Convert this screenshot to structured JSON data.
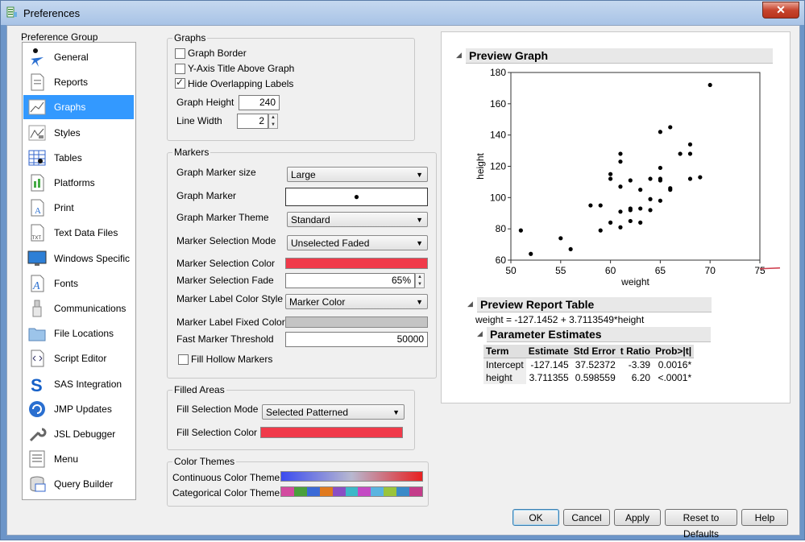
{
  "window": {
    "title": "Preferences",
    "close_glyph": "✕"
  },
  "sidebar": {
    "heading": "Preference Group",
    "items": [
      {
        "label": "General",
        "icon": "general-icon"
      },
      {
        "label": "Reports",
        "icon": "reports-icon"
      },
      {
        "label": "Graphs",
        "icon": "graphs-icon",
        "selected": true
      },
      {
        "label": "Styles",
        "icon": "styles-icon"
      },
      {
        "label": "Tables",
        "icon": "tables-icon"
      },
      {
        "label": "Platforms",
        "icon": "platforms-icon"
      },
      {
        "label": "Print",
        "icon": "print-icon"
      },
      {
        "label": "Text Data Files",
        "icon": "text-data-files-icon"
      },
      {
        "label": "Windows Specific",
        "icon": "monitor-icon"
      },
      {
        "label": "Fonts",
        "icon": "fonts-icon"
      },
      {
        "label": "Communications",
        "icon": "usb-icon"
      },
      {
        "label": "File Locations",
        "icon": "folder-icon"
      },
      {
        "label": "Script Editor",
        "icon": "script-editor-icon"
      },
      {
        "label": "SAS Integration",
        "icon": "sas-icon"
      },
      {
        "label": "JMP Updates",
        "icon": "updates-icon"
      },
      {
        "label": "JSL Debugger",
        "icon": "wrench-icon"
      },
      {
        "label": "Menu",
        "icon": "menu-icon"
      },
      {
        "label": "Query Builder",
        "icon": "database-icon"
      }
    ]
  },
  "graphs": {
    "title": "Graphs",
    "graph_border": {
      "label": "Graph Border",
      "checked": false
    },
    "y_axis_title": {
      "label": "Y-Axis Title Above Graph",
      "checked": false
    },
    "hide_overlap": {
      "label": "Hide Overlapping Labels",
      "checked": true
    },
    "graph_height_label": "Graph Height",
    "graph_height": "240",
    "line_width_label": "Line Width",
    "line_width": "2"
  },
  "markers": {
    "title": "Markers",
    "size_label": "Graph Marker size",
    "size_value": "Large",
    "marker_label": "Graph Marker",
    "marker_glyph": "●",
    "theme_label": "Graph Marker Theme",
    "theme_value": "Standard",
    "selection_mode_label": "Marker Selection Mode",
    "selection_mode_value": "Unselected Faded",
    "selection_color_label": "Marker Selection Color",
    "selection_color": "#f03a4a",
    "fade_label": "Marker Selection Fade",
    "fade_value": "65%",
    "label_style_label": "Marker Label Color Style",
    "label_style_value": "Marker Color",
    "label_fixed_label": "Marker Label Fixed Color",
    "label_fixed_color": "#c4c4c4",
    "threshold_label": "Fast Marker Threshold",
    "threshold_value": "50000",
    "fill_hollow": {
      "label": "Fill Hollow Markers",
      "checked": false
    }
  },
  "filled_areas": {
    "title": "Filled Areas",
    "mode_label": "Fill Selection Mode",
    "mode_value": "Selected Patterned",
    "color_label": "Fill Selection Color",
    "color": "#f03a4a"
  },
  "color_themes": {
    "title": "Color Themes",
    "continuous_label": "Continuous Color Theme",
    "continuous_colors": [
      "#3b4cf0",
      "#b8b8d0",
      "#e82020"
    ],
    "categorical_label": "Categorical Color Theme",
    "categorical_colors": [
      "#d34ba0",
      "#4aa03c",
      "#3b6ad6",
      "#e07a1e",
      "#8a4fc4",
      "#3db8c8",
      "#c44ac4",
      "#5ab4e0",
      "#9ac43c",
      "#3a8ac8",
      "#c43c8a"
    ]
  },
  "preview": {
    "graph_title": "Preview Graph",
    "report_title": "Preview Report Table",
    "equation": "weight = -127.1452 + 3.7113549*height",
    "param_title": "Parameter Estimates",
    "table": {
      "headers": [
        "Term",
        "Estimate",
        "Std Error",
        "t Ratio",
        "Prob>|t|"
      ],
      "rows": [
        [
          "Intercept",
          "-127.145",
          "37.52372",
          "-3.39",
          "0.0016*"
        ],
        [
          "height",
          "3.711355",
          "0.598559",
          "6.20",
          "<.0001*"
        ]
      ]
    }
  },
  "chart_data": {
    "type": "scatter",
    "xlabel": "weight",
    "ylabel": "height",
    "xlim": [
      50,
      75
    ],
    "ylim": [
      60,
      180
    ],
    "xticks": [
      50,
      55,
      60,
      65,
      70,
      75
    ],
    "yticks": [
      60,
      80,
      100,
      120,
      140,
      160,
      180
    ],
    "fit_line": {
      "intercept": -127.1452,
      "slope": 3.7113549,
      "color": "#d04050"
    },
    "points": [
      [
        51,
        79
      ],
      [
        52,
        64
      ],
      [
        55,
        74
      ],
      [
        56,
        67
      ],
      [
        58,
        95
      ],
      [
        59,
        79
      ],
      [
        59,
        95
      ],
      [
        60,
        84
      ],
      [
        60,
        112
      ],
      [
        60,
        115
      ],
      [
        61,
        81
      ],
      [
        61,
        91
      ],
      [
        61,
        107
      ],
      [
        61,
        123
      ],
      [
        61,
        128
      ],
      [
        62,
        85
      ],
      [
        62,
        92
      ],
      [
        62,
        93
      ],
      [
        62,
        111
      ],
      [
        63,
        84
      ],
      [
        63,
        93
      ],
      [
        63,
        105
      ],
      [
        64,
        92
      ],
      [
        64,
        99
      ],
      [
        64,
        112
      ],
      [
        65,
        98
      ],
      [
        65,
        111
      ],
      [
        65,
        112
      ],
      [
        65,
        119
      ],
      [
        65,
        142
      ],
      [
        66,
        105
      ],
      [
        66,
        106
      ],
      [
        66,
        145
      ],
      [
        67,
        128
      ],
      [
        68,
        112
      ],
      [
        68,
        128
      ],
      [
        68,
        134
      ],
      [
        69,
        113
      ],
      [
        70,
        172
      ]
    ]
  },
  "buttons": {
    "ok": "OK",
    "cancel": "Cancel",
    "apply": "Apply",
    "reset": "Reset to Defaults",
    "help": "Help"
  }
}
